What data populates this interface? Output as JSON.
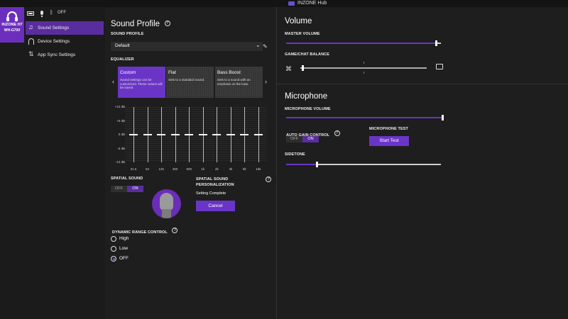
{
  "app": {
    "title": "INZONE Hub"
  },
  "device": {
    "name": "INZONE H7",
    "model": "WH-G700"
  },
  "status": {
    "bluetooth": "OFF"
  },
  "nav": [
    {
      "label": "Sound Settings",
      "icon": "music-note-icon",
      "active": true
    },
    {
      "label": "Device Settings",
      "icon": "headphones-icon",
      "active": false
    },
    {
      "label": "App Sync Settings",
      "icon": "sync-icon",
      "active": false
    }
  ],
  "sound_profile": {
    "title": "Sound Profile",
    "profile_label": "SOUND PROFILE",
    "profile_value": "Default",
    "equalizer_label": "EQUALIZER",
    "presets": [
      {
        "name": "Custom",
        "desc": "Sound settings can be customized. These values will be saved."
      },
      {
        "name": "Flat",
        "desc": "Sets to a standard sound."
      },
      {
        "name": "Bass Boost",
        "desc": "Sets to a sound with an emphasis on the lows."
      }
    ],
    "eq_axis": [
      "+12 dB",
      "+6 dB",
      "0 dB",
      "-6 dB",
      "-12 dB"
    ],
    "eq_bands": [
      {
        "freq": "31.5",
        "gain": 0
      },
      {
        "freq": "63",
        "gain": 0
      },
      {
        "freq": "125",
        "gain": 0
      },
      {
        "freq": "250",
        "gain": 0
      },
      {
        "freq": "500",
        "gain": 0
      },
      {
        "freq": "1k",
        "gain": 0
      },
      {
        "freq": "2k",
        "gain": 0
      },
      {
        "freq": "4k",
        "gain": 0
      },
      {
        "freq": "8k",
        "gain": 0
      },
      {
        "freq": "16k",
        "gain": 0
      }
    ],
    "spatial_label": "SPATIAL SOUND",
    "toggle_off": "OFF",
    "toggle_on": "ON",
    "personalization_label": "SPATIAL SOUND PERSONALIZATION",
    "personalization_status": "Setting Complete",
    "cancel_label": "Cancel",
    "drc_label": "DYNAMIC RANGE CONTROL",
    "drc_options": [
      "High",
      "Low",
      "OFF"
    ],
    "drc_selected": "OFF"
  },
  "volume": {
    "title": "Volume",
    "master_label": "MASTER VOLUME",
    "master_level": 0.97,
    "balance_label": "GAME/CHAT BALANCE",
    "balance_level": 0.02
  },
  "microphone": {
    "title": "Microphone",
    "volume_label": "MICROPHONE VOLUME",
    "volume_level": 1.0,
    "agc_label": "AUTO GAIN CONTROL",
    "agc_off": "OFF",
    "agc_on": "ON",
    "test_label": "MICROPHONE TEST",
    "test_button": "Start Test",
    "sidetone_label": "SIDETONE",
    "sidetone_level": 0.2
  },
  "colors": {
    "accent": "#6a35c7",
    "active_nav": "#5a2d9e",
    "background": "#1e1e1e"
  }
}
